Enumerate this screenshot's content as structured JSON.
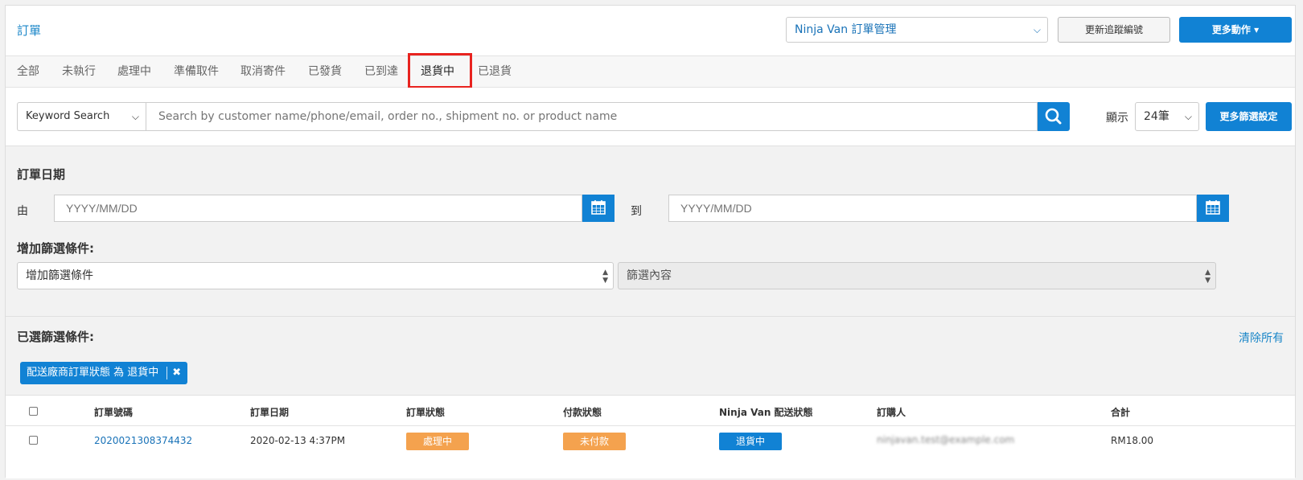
{
  "header": {
    "title": "訂單",
    "provider_select": "Ninja Van 訂單管理",
    "update_tracking_button": "更新追蹤編號",
    "more_actions_button": "更多動作 ▾"
  },
  "tabs": [
    {
      "label": "全部"
    },
    {
      "label": "未執行"
    },
    {
      "label": "處理中"
    },
    {
      "label": "準備取件"
    },
    {
      "label": "取消寄件"
    },
    {
      "label": "已發貨"
    },
    {
      "label": "已到達"
    },
    {
      "label": "退貨中",
      "active": true
    },
    {
      "label": "已退貨"
    }
  ],
  "search": {
    "type_select": "Keyword Search",
    "placeholder": "Search by customer name/phone/email, order no., shipment no. or product name",
    "show_label": "顯示",
    "count_select": "24筆",
    "more_filters_button": "更多篩選設定"
  },
  "date_filter": {
    "title": "訂單日期",
    "from_label": "由",
    "to_label": "到",
    "from_placeholder": "YYYY/MM/DD",
    "to_placeholder": "YYYY/MM/DD"
  },
  "add_filter": {
    "title": "增加篩選條件:",
    "condition_select": "增加篩選條件",
    "content_select": "篩選內容"
  },
  "selected_filters": {
    "title": "已選篩選條件:",
    "clear_all": "清除所有",
    "chips": [
      {
        "label": "配送廠商訂單狀態 為 退貨中"
      }
    ]
  },
  "table": {
    "columns": [
      "訂單號碼",
      "訂單日期",
      "訂單狀態",
      "付款狀態",
      "Ninja Van 配送狀態",
      "訂購人",
      "合計"
    ],
    "rows": [
      {
        "order_no": "2020021308374432",
        "date": "2020-02-13 4:37PM",
        "order_status": "處理中",
        "payment_status": "未付款",
        "delivery_status": "退貨中",
        "customer": "ninjavan.test@example.com",
        "total": "RM18.00"
      }
    ]
  },
  "colors": {
    "accent": "#1182d4",
    "highlight_box": "#e8231f",
    "badge_orange": "#f4a24e"
  }
}
